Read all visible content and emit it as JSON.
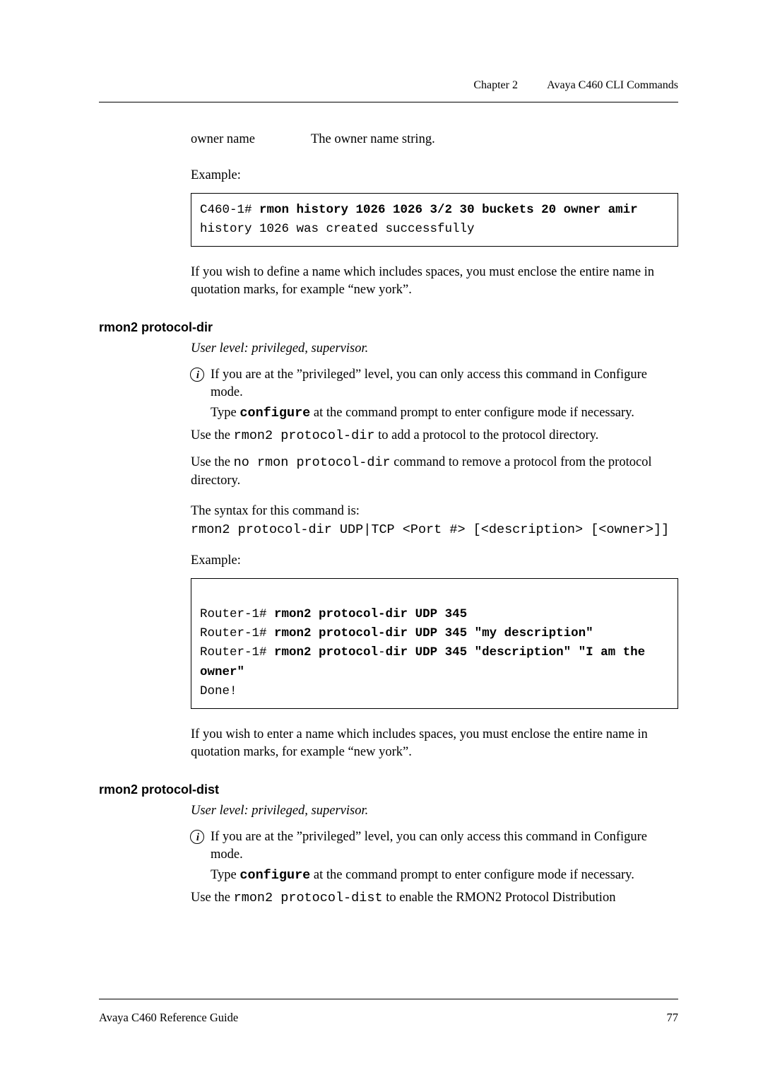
{
  "header": {
    "chapter": "Chapter 2",
    "title": "Avaya C460 CLI Commands"
  },
  "defrow": {
    "term": "owner name",
    "desc": "The owner name string."
  },
  "example_label": "Example:",
  "codebox1": {
    "line1_prefix": "C460-1# ",
    "line1_bold": "rmon history 1026 1026 3/2 30 buckets 20 owner amir",
    "line2": "history 1026 was created successfully"
  },
  "para_after_box1": "If you wish to define a name which includes spaces, you must enclose the entire name in quotation marks, for example “new york”.",
  "section1": {
    "head": "rmon2 protocol-dir",
    "userlevel": "User level: privileged, supervisor.",
    "note_l1": "If you are at the ”privileged” level, you can only access this command in Configure mode.",
    "note_l2a": "Type ",
    "note_l2_cmd": "configure",
    "note_l2b": " at the command prompt to enter configure mode if necessary.",
    "p1a": "Use the ",
    "p1_code": "rmon2 protocol-dir",
    "p1b": " to add a protocol to the protocol directory.",
    "p2a": "Use the ",
    "p2_code": "no rmon protocol-dir",
    "p2b": " command to remove a protocol from the protocol directory.",
    "syntax_intro": "The syntax for this command is:",
    "syntax_code": "rmon2 protocol-dir UDP|TCP <Port #> [<description> [<owner>]]",
    "example_label": "Example:",
    "codebox": {
      "l1_pfx": "Router-1# ",
      "l1_b": "rmon2 protocol-dir UDP 345",
      "l2_pfx": "Router-1# ",
      "l2_b": "rmon2 protocol-dir UDP 345 \"my description\"",
      "l3_pfx": "Router-1# ",
      "l3_b": "rmon2 protocol",
      "l3_mid": "-",
      "l3_b2": "dir UDP 345 \"description\" \"I am the owner\"",
      "l5": "Done!"
    },
    "after": "If you wish to enter a name which includes spaces, you must enclose the entire name in quotation marks, for example “new york”."
  },
  "section2": {
    "head": "rmon2 protocol-dist",
    "userlevel": "User level: privileged, supervisor.",
    "note_l1": "If you are at the ”privileged” level, you can only access this command in Configure mode.",
    "note_l2a": "Type ",
    "note_l2_cmd": "configure",
    "note_l2b": " at the command prompt to enter configure mode if necessary.",
    "p1a": "Use the ",
    "p1_code": "rmon2 protocol-dist",
    "p1b": " to enable the RMON2 Protocol Distribution"
  },
  "footer": {
    "left": "Avaya C460 Reference Guide",
    "right": "77"
  }
}
